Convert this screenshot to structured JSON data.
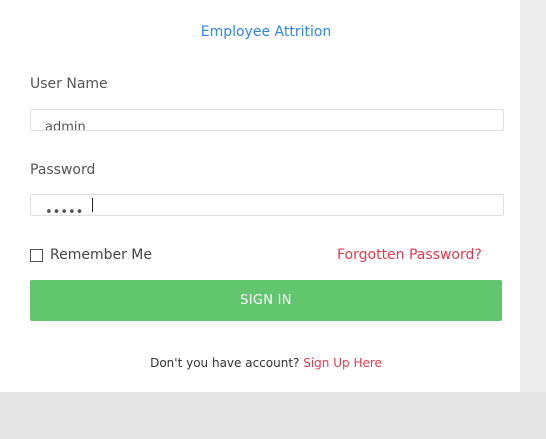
{
  "header": {
    "title": "Employee Attrition"
  },
  "form": {
    "username_label": "User Name",
    "username_value": "admin",
    "password_label": "Password",
    "password_value": "admin",
    "remember_label": "Remember Me",
    "forgot_label": "Forgotten Password?",
    "signin_label": "SIGN IN"
  },
  "footer": {
    "text": "Don't you have account?",
    "signup_label": "Sign Up Here"
  },
  "colors": {
    "accent": "#2f86e6",
    "danger": "#e8384f",
    "button": "#62c66e"
  }
}
